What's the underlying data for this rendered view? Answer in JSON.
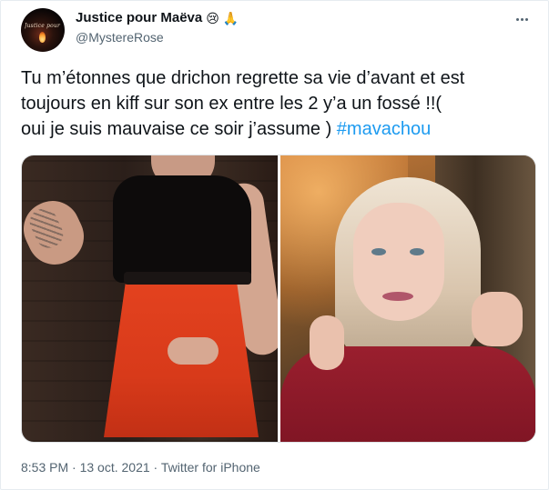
{
  "author": {
    "display_name": "Justice pour Maëva",
    "emojis": [
      "😢",
      "🙏"
    ],
    "handle": "@MystereRose",
    "avatar_text": "Justice pour Maëva"
  },
  "tweet": {
    "lines": [
      "Tu m’étonnes que drichon regrette sa vie d’avant et est",
      "toujours en kiff sur son ex entre les 2 y’a un fossé !!(",
      "oui je suis mauvaise ce soir j’assume ) "
    ],
    "hashtag": "#mavachou"
  },
  "meta": {
    "time": "8:53 PM",
    "separator": " · ",
    "date": "13 oct. 2021",
    "source": "Twitter for iPhone"
  },
  "icons": {
    "more": "more-horizontal-icon"
  }
}
